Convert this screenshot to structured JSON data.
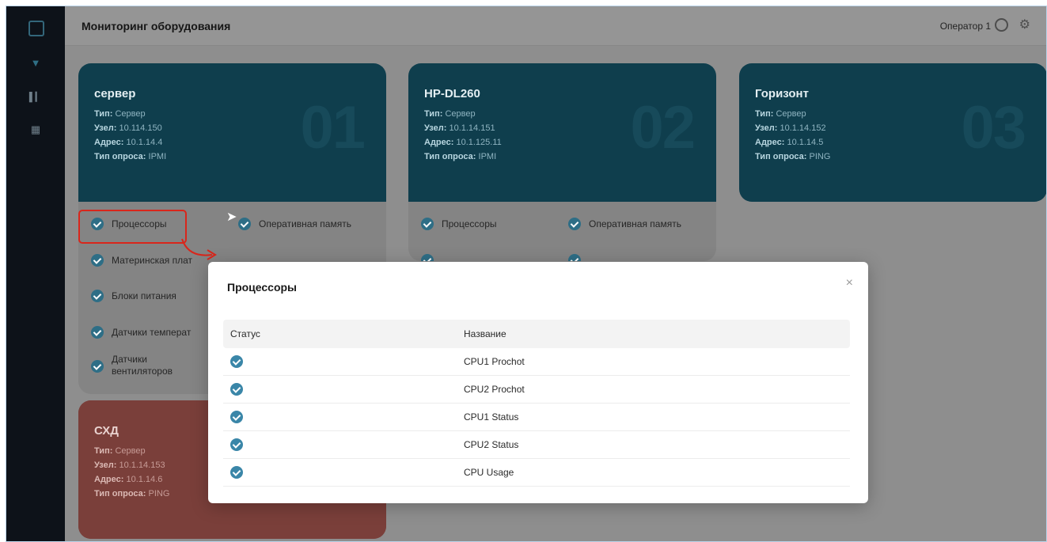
{
  "header": {
    "title": "Мониторинг оборудования",
    "user": "Оператор 1"
  },
  "cards": [
    {
      "name": "сервер",
      "number": "01",
      "type_label": "Тип:",
      "type_value": "Сервер",
      "node_label": "Узел:",
      "node_value": "10.114.150",
      "address_label": "Адрес:",
      "address_value": "10.1.14.4",
      "poll_label": "Тип опроса:",
      "poll_value": "IPMI",
      "components": [
        "Процессоры",
        "Оперативная память",
        "Материнская плат",
        "Блоки питания",
        "Датчики температ",
        "Датчики вентиляторов"
      ]
    },
    {
      "name": "HP-DL260",
      "number": "02",
      "type_label": "Тип:",
      "type_value": "Сервер",
      "node_label": "Узел:",
      "node_value": "10.1.14.151",
      "address_label": "Адрес:",
      "address_value": "10.1.125.11",
      "poll_label": "Тип опроса:",
      "poll_value": "IPMI",
      "components": [
        "Процессоры",
        "Оперативная память"
      ]
    },
    {
      "name": "Горизонт",
      "number": "03",
      "type_label": "Тип:",
      "type_value": "Сервер",
      "node_label": "Узел:",
      "node_value": "10.1.14.152",
      "address_label": "Адрес:",
      "address_value": "10.1.14.5",
      "poll_label": "Тип опроса:",
      "poll_value": "PING"
    },
    {
      "name": "СХД",
      "type_label": "Тип:",
      "type_value": "Сервер",
      "node_label": "Узел:",
      "node_value": "10.1.14.153",
      "address_label": "Адрес:",
      "address_value": "10.1.14.6",
      "poll_label": "Тип опроса:",
      "poll_value": "PING"
    }
  ],
  "modal": {
    "title": "Процессоры",
    "close": "×",
    "columns": [
      "Статус",
      "Название"
    ],
    "rows": [
      "CPU1 Prochot",
      "CPU2 Prochot",
      "CPU1 Status",
      "CPU2 Status",
      "CPU Usage"
    ]
  },
  "colors": {
    "card_normal": "#0f3e4d",
    "card_alert": "#7a3f3a",
    "status_ok": "#3a86a8",
    "highlight": "#d9261b"
  }
}
